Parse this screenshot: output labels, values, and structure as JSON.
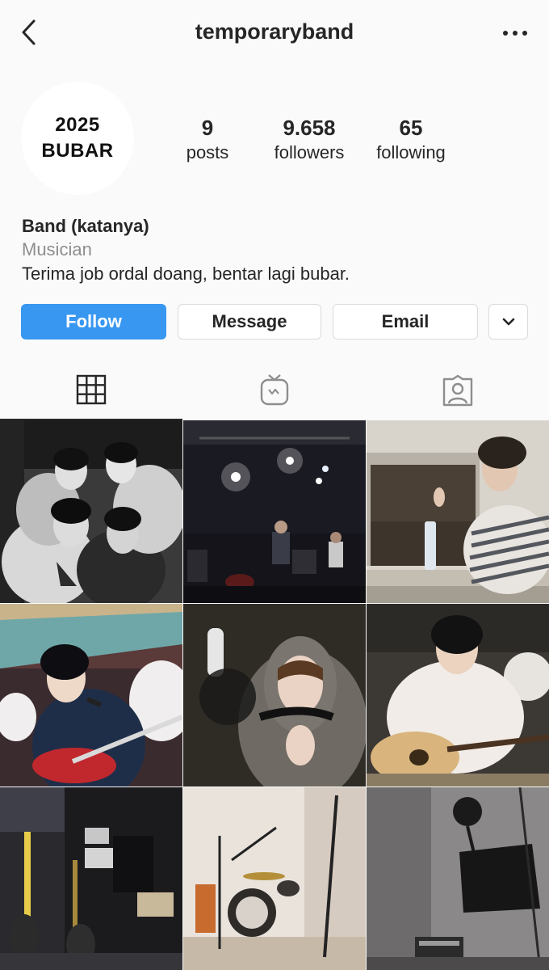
{
  "header": {
    "username": "temporaryband",
    "back_icon": "chevron-left-icon",
    "more_icon": "more-horizontal-icon"
  },
  "profile": {
    "avatar_line1": "2025",
    "avatar_line2": "BUBAR",
    "stats": {
      "posts": {
        "value": "9",
        "label": "posts"
      },
      "followers": {
        "value": "9.658",
        "label": "followers"
      },
      "following": {
        "value": "65",
        "label": "following"
      }
    },
    "name": "Band (katanya)",
    "category": "Musician",
    "bio": "Terima job ordal doang, bentar lagi bubar."
  },
  "actions": {
    "follow": "Follow",
    "message": "Message",
    "email": "Email",
    "more_icon": "chevron-down-icon"
  },
  "tabs": [
    {
      "name": "grid",
      "icon": "grid-icon",
      "active": true
    },
    {
      "name": "igtv",
      "icon": "igtv-icon",
      "active": false
    },
    {
      "name": "tagged",
      "icon": "tagged-person-icon",
      "active": false
    }
  ],
  "posts": [
    {
      "subject": "band-group-photo"
    },
    {
      "subject": "live-stage-performance"
    },
    {
      "subject": "member-in-studio"
    },
    {
      "subject": "bassist-singing"
    },
    {
      "subject": "member-in-hoodie-at-mic"
    },
    {
      "subject": "member-with-acoustic-guitar"
    },
    {
      "subject": "backstage-guitars"
    },
    {
      "subject": "drum-kit-room"
    },
    {
      "subject": "recording-booth"
    }
  ],
  "colors": {
    "accent": "#3897f0",
    "text": "#262626",
    "muted": "#8e8e8e",
    "border": "#dbdbdb",
    "background": "#fafafa"
  }
}
